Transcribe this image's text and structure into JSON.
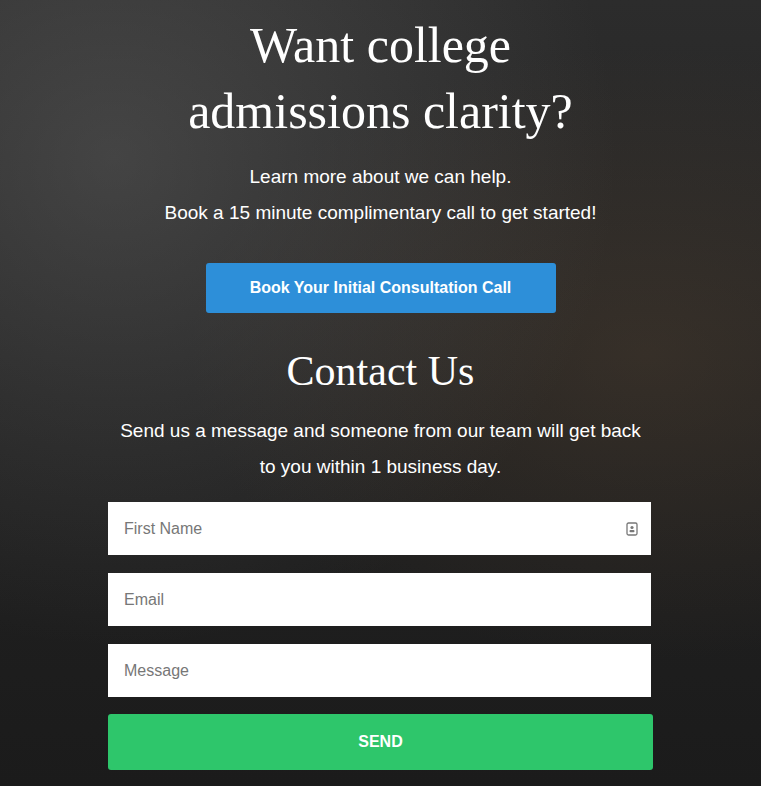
{
  "hero": {
    "title": "Want college admissions clarity?",
    "lines": [
      "Learn more about we can help.",
      "Book a 15 minute complimentary call to get started!"
    ],
    "button": "Book Your Initial Consultation Call"
  },
  "contact": {
    "title": "Contact Us",
    "description": "Send us a message and someone from our team will get back to you within 1 business day.",
    "fields": [
      {
        "placeholder": "First Name",
        "kind": "name"
      },
      {
        "placeholder": "Email",
        "kind": "email"
      },
      {
        "placeholder": "Message",
        "kind": "message"
      }
    ],
    "button": "SEND"
  }
}
